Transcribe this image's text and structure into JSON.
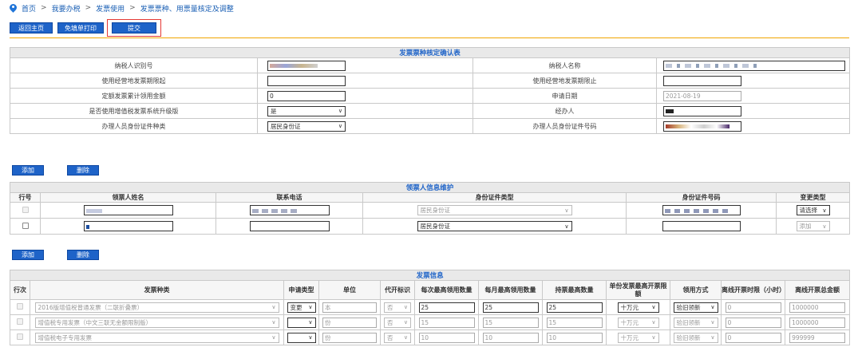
{
  "breadcrumb": [
    "首页",
    "我要办税",
    "发票使用",
    "发票票种、用票量核定及调整"
  ],
  "breadcrumb_sep": ">",
  "toolbar": {
    "home": "返回主页",
    "print": "免填单打印",
    "submit": "提交"
  },
  "confirm": {
    "caption": "发票票种核定确认表",
    "tax_id_label": "纳税人识别号",
    "taxpayer_name_label": "纳税人名称",
    "period_start_label": "使用经营地发票期限起",
    "period_end_label": "使用经营地发票期限止",
    "amount_label": "定额发票累计领用金额",
    "amount_value": "0",
    "apply_date_label": "申请日期",
    "apply_date_value": "2021-08-19",
    "upgrade_label": "是否使用增值税发票系统升级版",
    "upgrade_value": "是",
    "handler_label": "经办人",
    "id_type_label": "办理人员身份证件种类",
    "id_type_value": "居民身份证",
    "id_no_label": "办理人员身份证件号码"
  },
  "recipient": {
    "add": "添加",
    "delete": "删除",
    "caption": "领票人信息维护",
    "headers": [
      "行号",
      "领票人姓名",
      "联系电话",
      "身份证件类型",
      "身份证件号码",
      "变更类型"
    ],
    "rows": [
      {
        "id_type": "居民身份证",
        "change": "请选择",
        "disabled": true
      },
      {
        "id_type": "居民身份证",
        "change": "添加",
        "disabled": false
      }
    ]
  },
  "invoice": {
    "add": "添加",
    "delete": "删除",
    "caption": "发票信息",
    "headers": [
      "行次",
      "发票种类",
      "申请类型",
      "单位",
      "代开标识",
      "每次最高领用数量",
      "每月最高领用数量",
      "持票最高数量",
      "单份发票最高开票限额",
      "领用方式",
      "离线开票时限（小时）",
      "离线开票总金额"
    ],
    "rows": [
      {
        "type": "2016版增值税普通发票（二联折叠票）",
        "apply": "变更",
        "unit": "本",
        "agent": "否",
        "per_time": "25",
        "per_month": "25",
        "hold": "25",
        "limit": "十万元",
        "method": "验旧领新",
        "offline_hours": "0",
        "offline_total": "1000000"
      },
      {
        "type": "增值税专用发票（中文三联无金额限制版）",
        "apply": "",
        "unit": "份",
        "agent": "否",
        "per_time": "15",
        "per_month": "15",
        "hold": "15",
        "limit": "十万元",
        "method": "验旧领新",
        "offline_hours": "0",
        "offline_total": "1000000"
      },
      {
        "type": "增值税电子专用发票",
        "apply": "",
        "unit": "份",
        "agent": "否",
        "per_time": "10",
        "per_month": "10",
        "hold": "10",
        "limit": "十万元",
        "method": "验旧领新",
        "offline_hours": "0",
        "offline_total": "999999"
      }
    ]
  },
  "colors": {
    "accent": "#1e63c8",
    "rule": "#f0a500",
    "highlight": "#e53935"
  }
}
